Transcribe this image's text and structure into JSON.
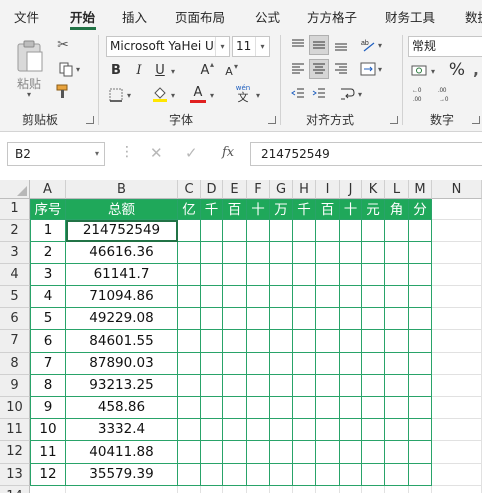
{
  "tabs": [
    "文件",
    "开始",
    "插入",
    "页面布局",
    "公式",
    "方方格子",
    "财务工具",
    "数据"
  ],
  "clipboard": {
    "paste_label": "粘贴",
    "group_label": "剪贴板"
  },
  "font": {
    "name": "Microsoft YaHei UI",
    "size": "11",
    "bold": "B",
    "italic": "I",
    "underline": "U",
    "grow": "A",
    "shrink": "A",
    "font_color_glyph": "A",
    "wen_top": "wén",
    "wen_bottom": "文",
    "group_label": "字体"
  },
  "alignment": {
    "group_label": "对齐方式"
  },
  "number": {
    "format": "常规",
    "percent": "%",
    "group_label": "数字"
  },
  "formula_bar": {
    "cell_ref": "B2",
    "fx": "fx",
    "content": "214752549"
  },
  "sheet": {
    "columns": [
      "A",
      "B",
      "C",
      "D",
      "E",
      "F",
      "G",
      "H",
      "I",
      "J",
      "K",
      "L",
      "M",
      "N"
    ],
    "header_row": [
      "序号",
      "总额",
      "亿",
      "千",
      "百",
      "十",
      "万",
      "千",
      "百",
      "十",
      "元",
      "角",
      "分"
    ],
    "rows": [
      [
        "1",
        "214752549"
      ],
      [
        "2",
        "46616.36"
      ],
      [
        "3",
        "61141.7"
      ],
      [
        "4",
        "71094.86"
      ],
      [
        "5",
        "49229.08"
      ],
      [
        "6",
        "84601.55"
      ],
      [
        "7",
        "87890.03"
      ],
      [
        "8",
        "93213.25"
      ],
      [
        "9",
        "458.86"
      ],
      [
        "10",
        "3332.4"
      ],
      [
        "11",
        "40411.88"
      ],
      [
        "12",
        "35579.39"
      ]
    ],
    "row_numbers": [
      "1",
      "2",
      "3",
      "4",
      "5",
      "6",
      "7",
      "8",
      "9",
      "10",
      "11",
      "12",
      "13",
      "14"
    ]
  },
  "colors": {
    "accent": "#217346",
    "header_fill": "#1fa85a",
    "table_border": "#29a369",
    "font_color": "#e02020",
    "highlight": "#ffe600"
  }
}
